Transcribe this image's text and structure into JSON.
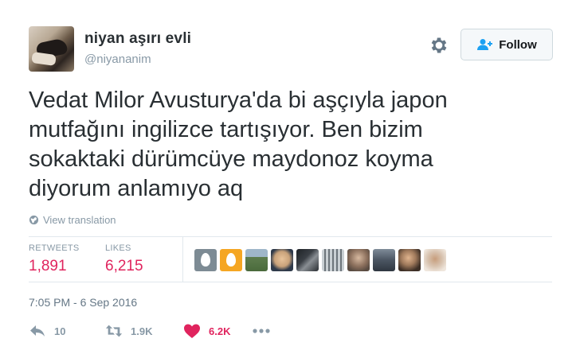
{
  "user": {
    "name": "niyan aşırı evli",
    "handle": "@niyananim"
  },
  "follow_button": {
    "label": "Follow"
  },
  "tweet": {
    "text": "Vedat Milor Avusturya'da bi aşçıyla japon\nmutfağını ingilizce tartışıyor. Ben bizim\nsokaktaki dürümcüye maydonoz koyma\ndiyorum anlamıyo aq",
    "view_translation": "View translation",
    "timestamp": "7:05 PM - 6 Sep 2016"
  },
  "stats": {
    "retweets_label": "RETWEETS",
    "retweets_value": "1,891",
    "likes_label": "LIKES",
    "likes_value": "6,215"
  },
  "likers": [
    {
      "icon": "default-egg-avatar",
      "color": "#7d8b94"
    },
    {
      "icon": "default-egg-avatar",
      "color": "#f5a623"
    },
    {
      "icon": "photo-avatar",
      "color": "#5e7d4e"
    },
    {
      "icon": "photo-avatar",
      "color": "#c9a27a"
    },
    {
      "icon": "photo-avatar",
      "color": "#3a3f45"
    },
    {
      "icon": "photo-avatar",
      "color": "#9aa2a8"
    },
    {
      "icon": "photo-avatar",
      "color": "#6f6258"
    },
    {
      "icon": "photo-avatar",
      "color": "#4b5562"
    },
    {
      "icon": "photo-avatar",
      "color": "#a07a5c"
    },
    {
      "icon": "photo-avatar",
      "color": "#d8c3b0"
    }
  ],
  "actions": {
    "reply_count": "10",
    "retweet_count": "1.9K",
    "like_count": "6.2K"
  },
  "colors": {
    "accent": "#e0245e",
    "secondary_text": "#8899a6",
    "follow_icon": "#1da1f2"
  }
}
